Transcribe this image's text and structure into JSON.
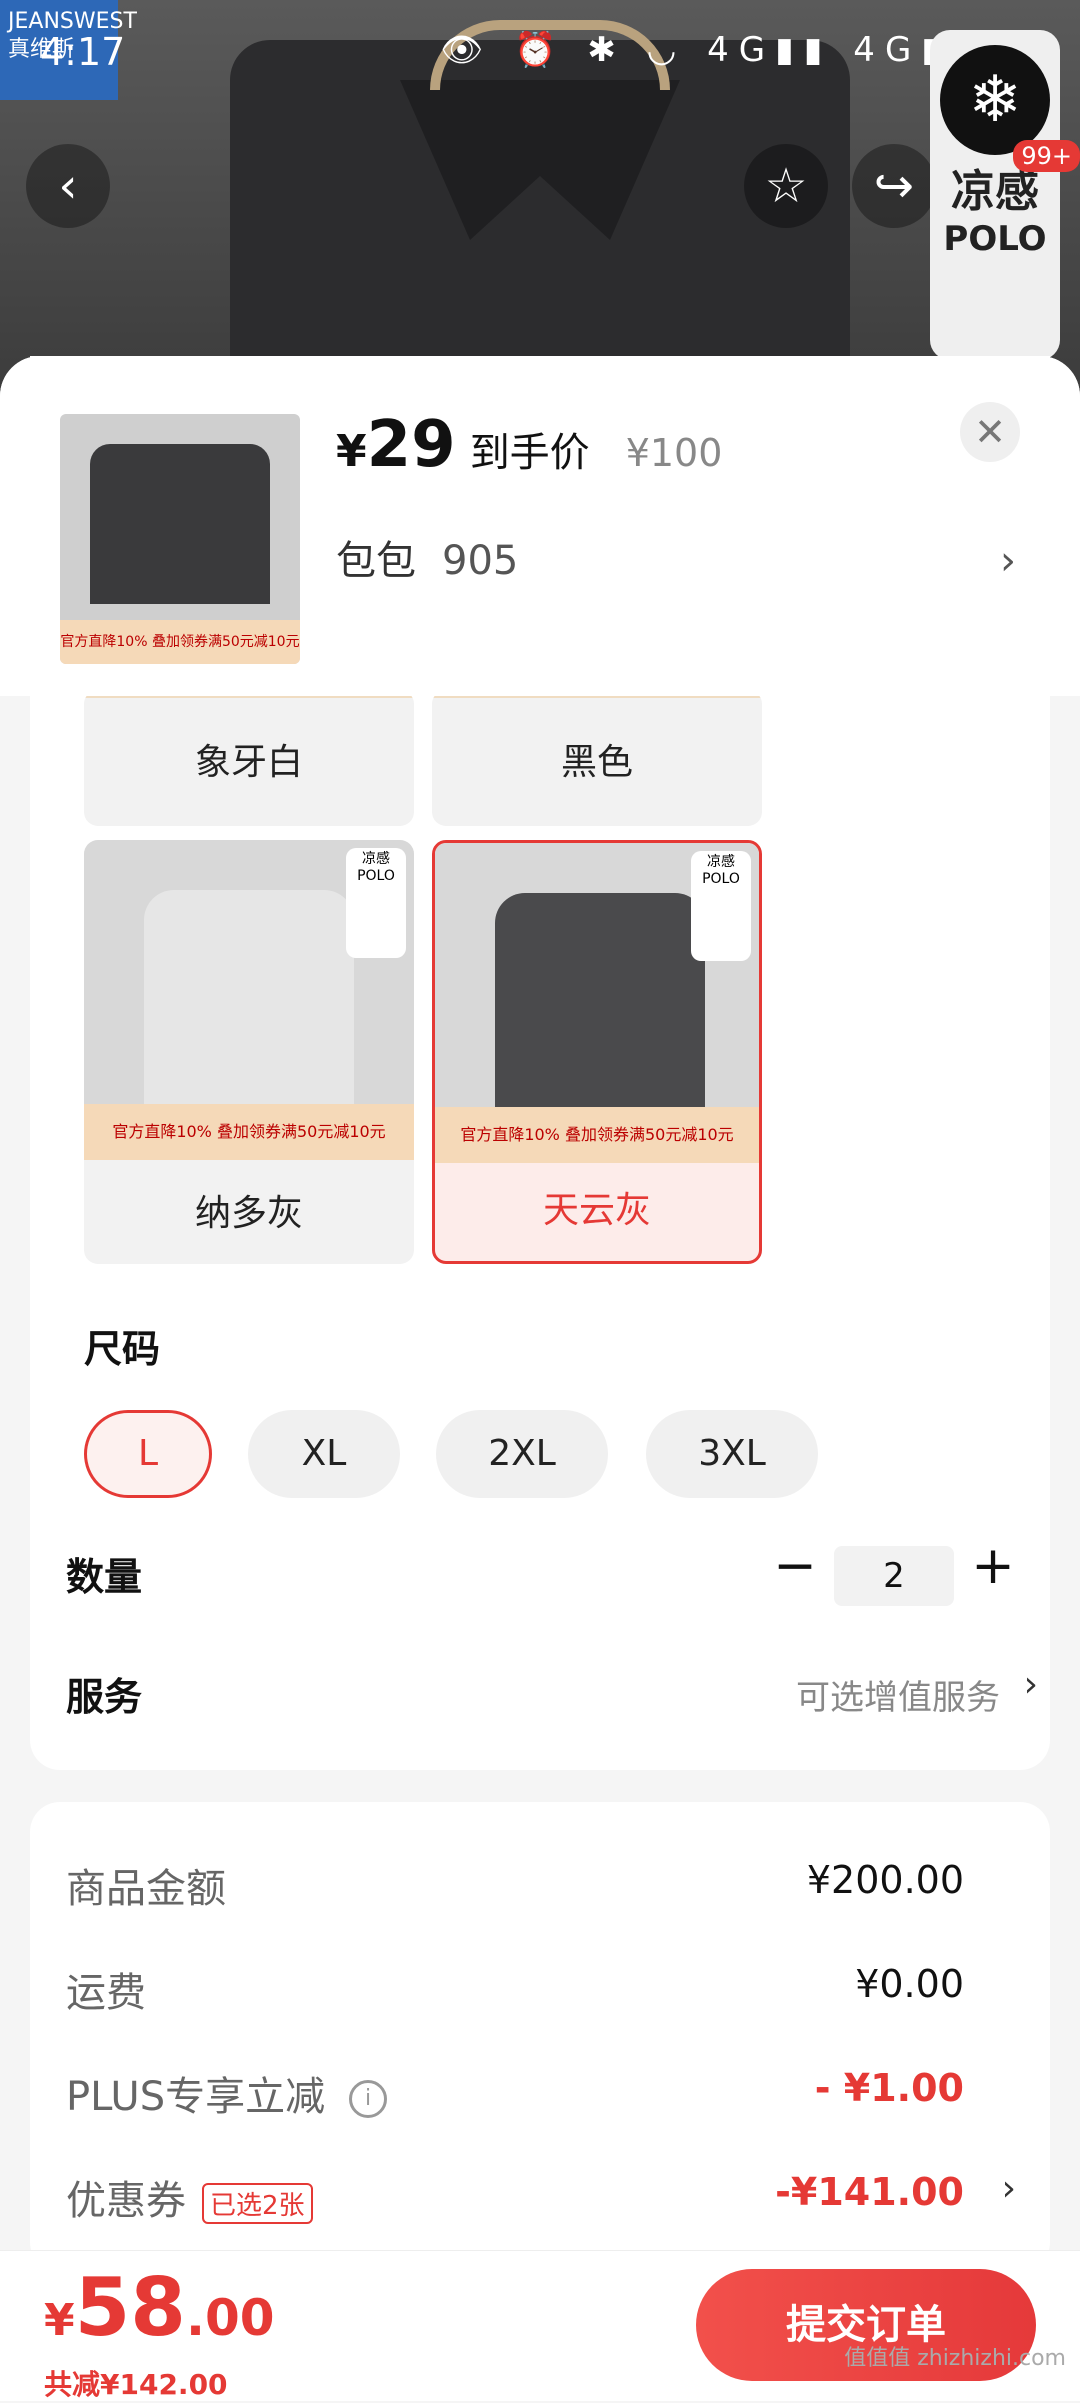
{
  "status_bar": {
    "time": "4:17",
    "icons": "👁 ⏰ ✱ ◡ 4G▮▮ 4G▮"
  },
  "background": {
    "brand_badge": "JEANSWEST 真维斯",
    "cool_card": {
      "title": "凉感",
      "subtitle": "POLO"
    },
    "cart_badge": "99+"
  },
  "product": {
    "price_symbol": "¥",
    "price": "29",
    "price_label": "到手价",
    "original_price": "¥100",
    "package_label": "包包",
    "package_value": "905",
    "thumb_banner": "官方直降10% 叠加领券满50元减10元"
  },
  "colors": [
    {
      "label": "象牙白"
    },
    {
      "label": "黑色"
    },
    {
      "label": "纳多灰",
      "banner": "官方直降10% 叠加领券满50元减10元",
      "tag": "凉感 POLO"
    },
    {
      "label": "天云灰",
      "banner": "官方直降10% 叠加领券满50元减10元",
      "tag": "凉感 POLO",
      "selected": true
    }
  ],
  "size_section": {
    "title": "尺码",
    "options": [
      "L",
      "XL",
      "2XL",
      "3XL"
    ],
    "selected": "L"
  },
  "quantity": {
    "title": "数量",
    "minus": "−",
    "plus": "+",
    "value": "2"
  },
  "service": {
    "title": "服务",
    "value": "可选增值服务",
    "chevron": "›"
  },
  "summary": {
    "goods_label": "商品金额",
    "goods_value": "¥200.00",
    "shipping_label": "运费",
    "shipping_value": "¥0.00",
    "plus_label": "PLUS专享立减",
    "plus_value": "- ¥1.00",
    "coupon_label": "优惠券",
    "coupon_tag": "已选2张",
    "coupon_value": "-¥141.00"
  },
  "bottom": {
    "total_symbol": "¥",
    "total_int": "58",
    "total_dec": ".00",
    "saved": "共减¥142.00",
    "submit": "提交订单",
    "watermark": "值值值 zhizhizhi.com"
  },
  "colors_theme": {
    "accent": "#e53935"
  }
}
